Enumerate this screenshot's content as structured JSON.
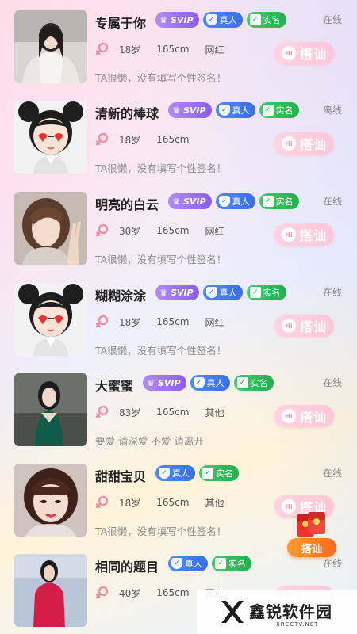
{
  "colors": {
    "svip": "#8b5cf0",
    "real": "#3b6ee8",
    "verified": "#22b04f",
    "chat_button": "#ffc7d8",
    "female_icon": "#f28aa6",
    "float_button": "#ff7a20"
  },
  "users": [
    {
      "name": "专属于你",
      "svip": true,
      "svip_label": "SVIP",
      "real_label": "真人",
      "verified_label": "实名",
      "status": "在线",
      "gender_icon": "female-icon",
      "age": "18岁",
      "height": "165cm",
      "tag": "网红",
      "signature": "TA很懒，没有填写个性签名！",
      "chat_label": "搭讪",
      "avatar": "photo-woman-white-fur"
    },
    {
      "name": "清新的棒球",
      "svip": true,
      "svip_label": "SVIP",
      "real_label": "真人",
      "verified_label": "实名",
      "status": "离线",
      "gender_icon": "female-icon",
      "age": "18岁",
      "height": "165cm",
      "tag": "",
      "signature": "TA很懒，没有填写个性签名！",
      "chat_label": "搭讪",
      "avatar": "cartoon-girl-heart-glasses"
    },
    {
      "name": "明亮的白云",
      "svip": true,
      "svip_label": "SVIP",
      "real_label": "真人",
      "verified_label": "实名",
      "status": "在线",
      "gender_icon": "female-icon",
      "age": "30岁",
      "height": "165cm",
      "tag": "网红",
      "signature": "TA很懒，没有填写个性签名！",
      "chat_label": "搭讪",
      "avatar": "photo-woman-peace-sign"
    },
    {
      "name": "糊糊涂涂",
      "svip": true,
      "svip_label": "SVIP",
      "real_label": "真人",
      "verified_label": "实名",
      "status": "在线",
      "gender_icon": "female-icon",
      "age": "18岁",
      "height": "165cm",
      "tag": "网红",
      "signature": "TA很懒，没有填写个性签名！",
      "chat_label": "搭讪",
      "avatar": "cartoon-girl-heart-glasses"
    },
    {
      "name": "大蜜蜜",
      "svip": true,
      "svip_label": "SVIP",
      "real_label": "真人",
      "verified_label": "实名",
      "status": "在线",
      "gender_icon": "female-icon",
      "age": "83岁",
      "height": "165cm",
      "tag": "其他",
      "signature": "要爱  请深爱  不爱  请离开",
      "chat_label": "搭讪",
      "avatar": "photo-woman-green-dress"
    },
    {
      "name": "甜甜宝贝",
      "svip": false,
      "svip_label": "",
      "real_label": "真人",
      "verified_label": "实名",
      "status": "在线",
      "gender_icon": "female-icon",
      "age": "18岁",
      "height": "165cm",
      "tag": "其他",
      "signature": "TA很懒，没有填写个性签名！",
      "chat_label": "搭讪",
      "avatar": "photo-woman-bangs"
    },
    {
      "name": "相同的题目",
      "svip": false,
      "svip_label": "",
      "real_label": "真人",
      "verified_label": "实名",
      "status": "在线",
      "gender_icon": "female-icon",
      "age": "40岁",
      "height": "165cm",
      "tag": "网红",
      "signature": "",
      "chat_label": "搭讪",
      "avatar": "photo-woman-red-coat"
    }
  ],
  "float_button": {
    "label": "搭讪",
    "icon": "red-envelope-icon"
  },
  "watermark": {
    "brand": "鑫锐软件园",
    "url": "XRCCTV.NET"
  }
}
